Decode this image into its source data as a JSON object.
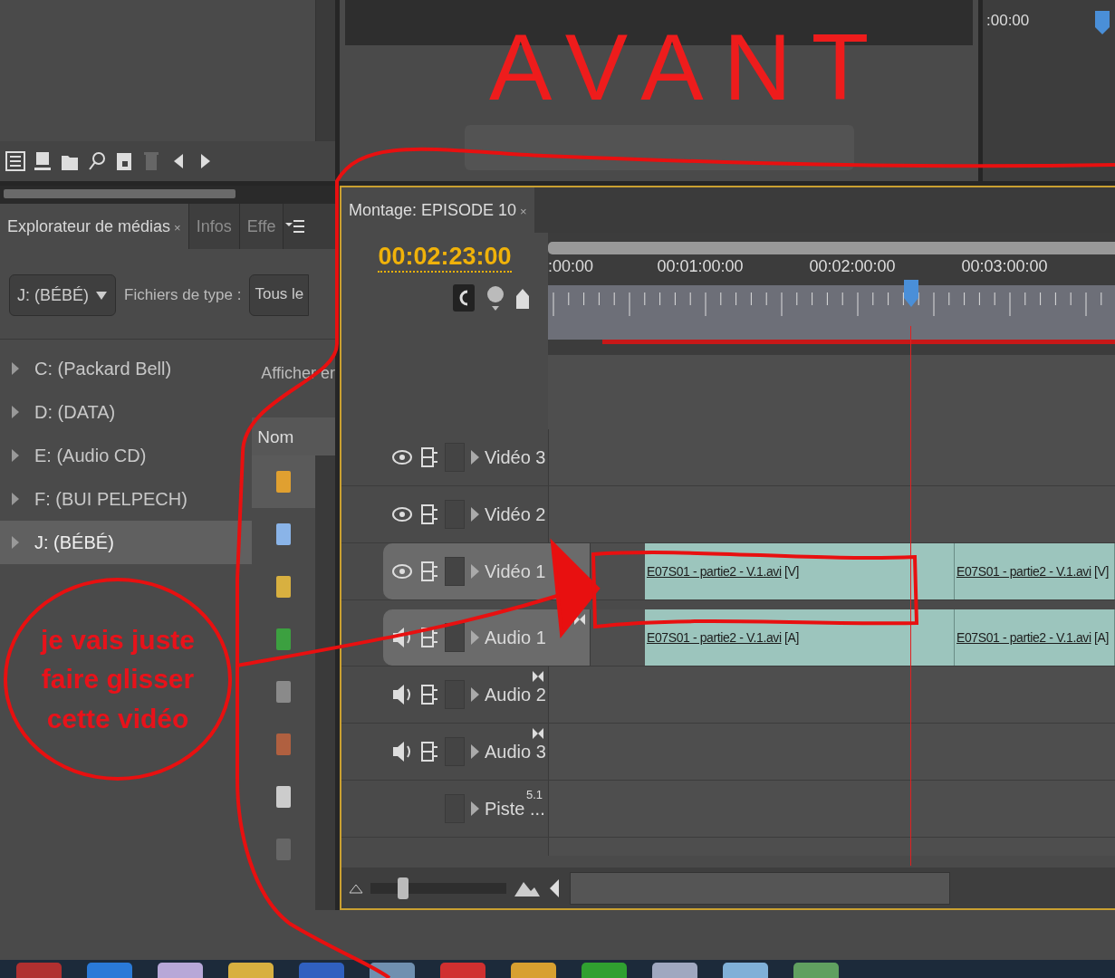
{
  "annotations": {
    "title": "AVANT",
    "note": "je vais juste faire glisser cette vidéo"
  },
  "program_monitor": {
    "timecode": ":00:00"
  },
  "media_browser": {
    "tabs": [
      {
        "label": "Explorateur de médias",
        "selected": true,
        "close": "×"
      },
      {
        "label": "Infos",
        "selected": false
      },
      {
        "label": "Effe",
        "selected": false
      }
    ],
    "drive_select": "J: (BÉBÉ)",
    "file_type_label": "Fichiers de type :",
    "file_type_value": "Tous le",
    "drives": [
      {
        "label": "C: (Packard Bell)",
        "selected": false
      },
      {
        "label": "D: (DATA)",
        "selected": false
      },
      {
        "label": "E: (Audio CD)",
        "selected": false
      },
      {
        "label": "F: (BUI PELPECH)",
        "selected": false
      },
      {
        "label": "J: (BÉBÉ)",
        "selected": true
      }
    ],
    "view_label": "Afficher er",
    "column": "Nom"
  },
  "sequence": {
    "tab": "Montage: EPISODE 10",
    "tab_close": "×",
    "timecode": "00:02:23:00",
    "ruler_labels": [
      ":00:00",
      "00:01:00:00",
      "00:02:00:00",
      "00:03:00:00"
    ],
    "tracks": [
      {
        "kind": "video",
        "name": "Vidéo 3",
        "targeted": false
      },
      {
        "kind": "video",
        "name": "Vidéo 2",
        "targeted": false
      },
      {
        "kind": "video",
        "name": "Vidéo 1",
        "targeted": true,
        "clips": [
          {
            "name": "E07S01 - partie2 - V.1.avi",
            "tag": "[V]"
          },
          {
            "name": "E07S01 - partie2 - V.1.avi",
            "tag": "[V]"
          }
        ]
      },
      {
        "kind": "audio",
        "name": "Audio 1",
        "targeted": true,
        "clips": [
          {
            "name": "E07S01 - partie2 - V.1.avi",
            "tag": "[A]"
          },
          {
            "name": "E07S01 - partie2 - V.1.avi",
            "tag": "[A]"
          }
        ]
      },
      {
        "kind": "audio",
        "name": "Audio 2",
        "targeted": false
      },
      {
        "kind": "audio",
        "name": "Audio 3",
        "targeted": false
      },
      {
        "kind": "master",
        "name": "Piste ...",
        "format": "5.1",
        "targeted": false
      }
    ],
    "zoom": {
      "level": 0.2
    }
  }
}
